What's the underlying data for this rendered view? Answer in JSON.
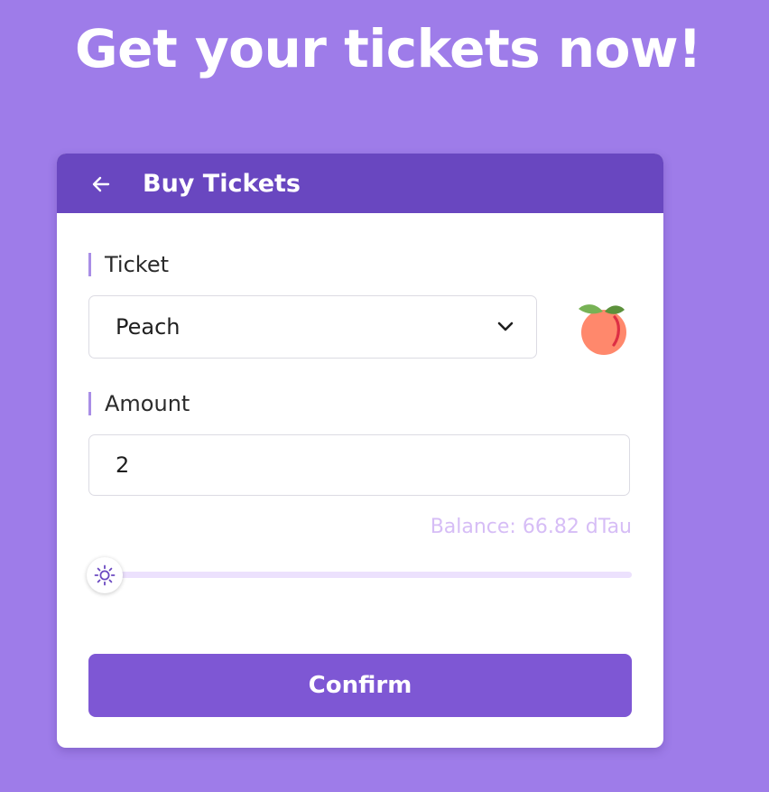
{
  "page": {
    "title": "Get your tickets now!"
  },
  "card": {
    "title": "Buy Tickets",
    "back_icon": "arrow-left-icon"
  },
  "ticket": {
    "label": "Ticket",
    "selected": "Peach",
    "dropdown_icon": "chevron-down-icon",
    "preview_icon": "peach-emoji"
  },
  "amount": {
    "label": "Amount",
    "value": "2"
  },
  "balance": {
    "text": "Balance: 66.82 dTau"
  },
  "slider": {
    "value_fraction": 0,
    "thumb_icon": "sun-icon"
  },
  "actions": {
    "confirm_label": "Confirm"
  },
  "colors": {
    "background": "#9e7ce9",
    "header": "#6947c0",
    "button": "#7e57d4",
    "balance_text": "#d6bdf6",
    "slider_track": "#ece1fd"
  }
}
